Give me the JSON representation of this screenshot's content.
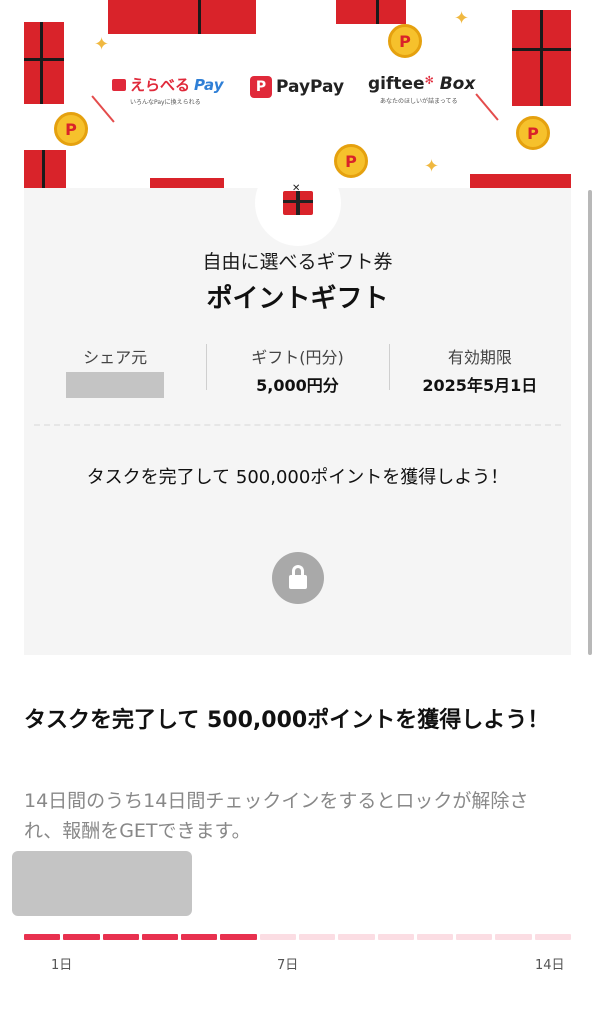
{
  "banner": {
    "logos": {
      "erabel": {
        "main": "えらべる",
        "pay": "Pay",
        "sub": "いろんなPayに換えられる"
      },
      "paypay": {
        "mark": "P",
        "text": "PayPay"
      },
      "giftee": {
        "main": "giftee",
        "box": "Box",
        "sub": "あなたのほしいが詰まってる"
      }
    },
    "coin_symbol": "P"
  },
  "gift": {
    "subtitle": "自由に選べるギフト券",
    "title": "ポイントギフト"
  },
  "info": [
    {
      "label": "シェア元",
      "value": ""
    },
    {
      "label": "ギフト(円分)",
      "value": "5,000円分"
    },
    {
      "label": "有効期限",
      "value": "2025年5月1日"
    }
  ],
  "card_task_text": "タスクを完了して 500,000ポイントを獲得しよう！",
  "section": {
    "title": "タスクを完了して 500,000ポイントを獲得しよう！",
    "description": "14日間のうち14日間チェックインをするとロックが解除され、報酬をGETできます。"
  },
  "progress": {
    "completed_segments": 6,
    "total_segments": 14,
    "labels": {
      "start": "1日",
      "mid": "7日",
      "end": "14日"
    },
    "accent_color": "#e8314f",
    "track_color": "#fbdde3"
  },
  "icons": {
    "lock": "lock-icon",
    "gift": "gift-icon"
  },
  "colors": {
    "brand_red": "#d9232a",
    "coin": "#f6c12c"
  }
}
